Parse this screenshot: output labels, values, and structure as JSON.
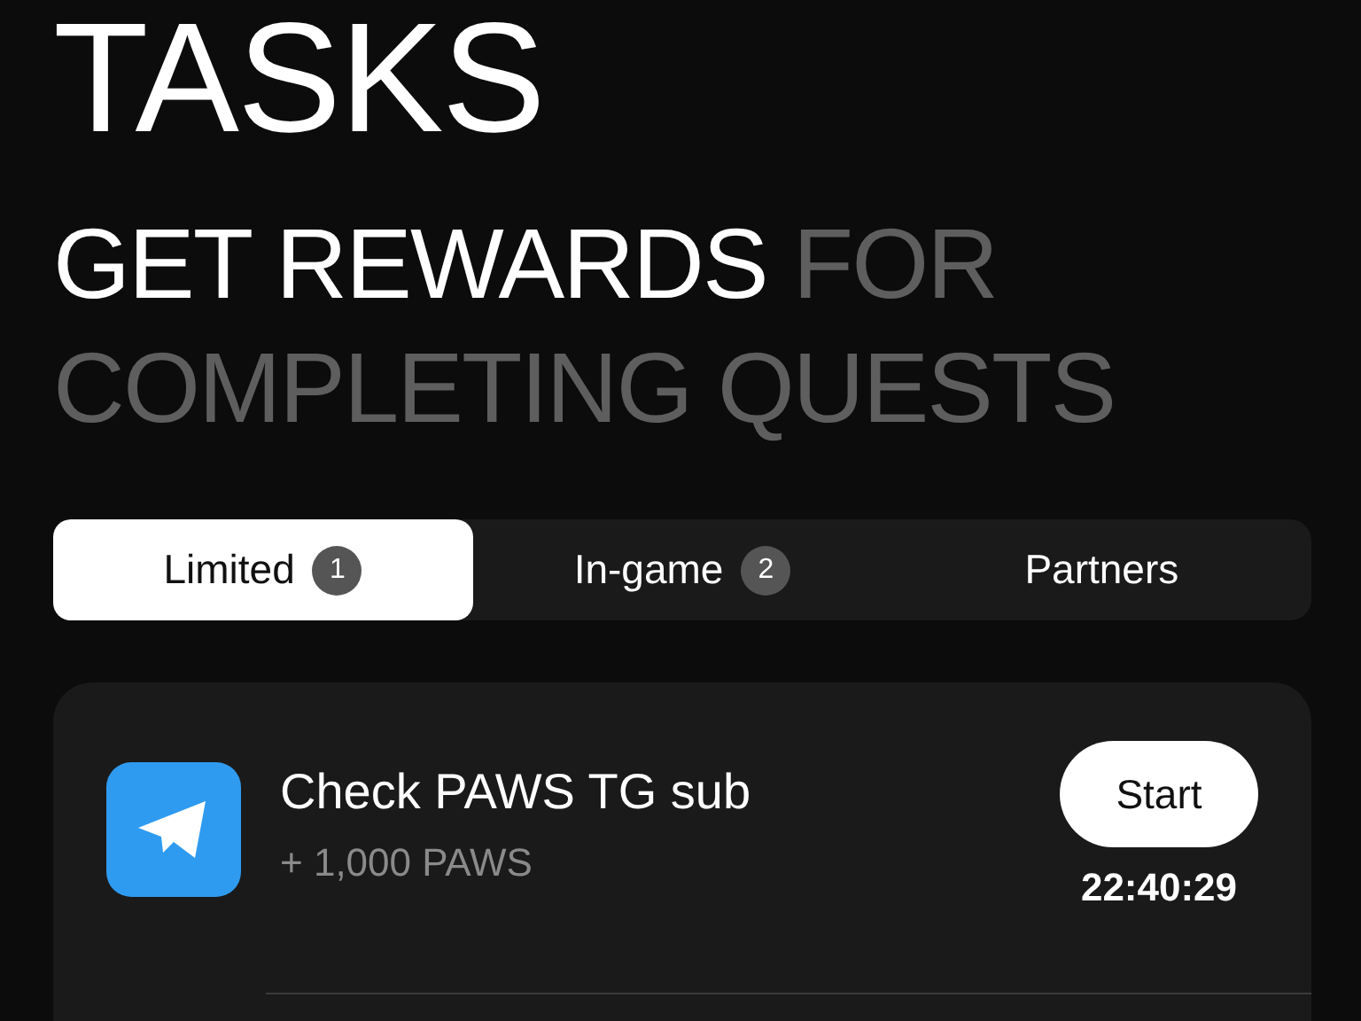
{
  "title": "TASKS",
  "heading": {
    "highlight": "GET REWARDS",
    "rest": "FOR COMPLETING QUESTS"
  },
  "tabs": [
    {
      "label": "Limited",
      "badge": "1",
      "selected": true
    },
    {
      "label": "In-game",
      "badge": "2",
      "selected": false
    },
    {
      "label": "Partners",
      "selected": false
    }
  ],
  "tasks": [
    {
      "title": "Check PAWS TG sub",
      "reward": "+ 1,000 PAWS",
      "button": "Start",
      "timer": "22:40:29"
    }
  ]
}
